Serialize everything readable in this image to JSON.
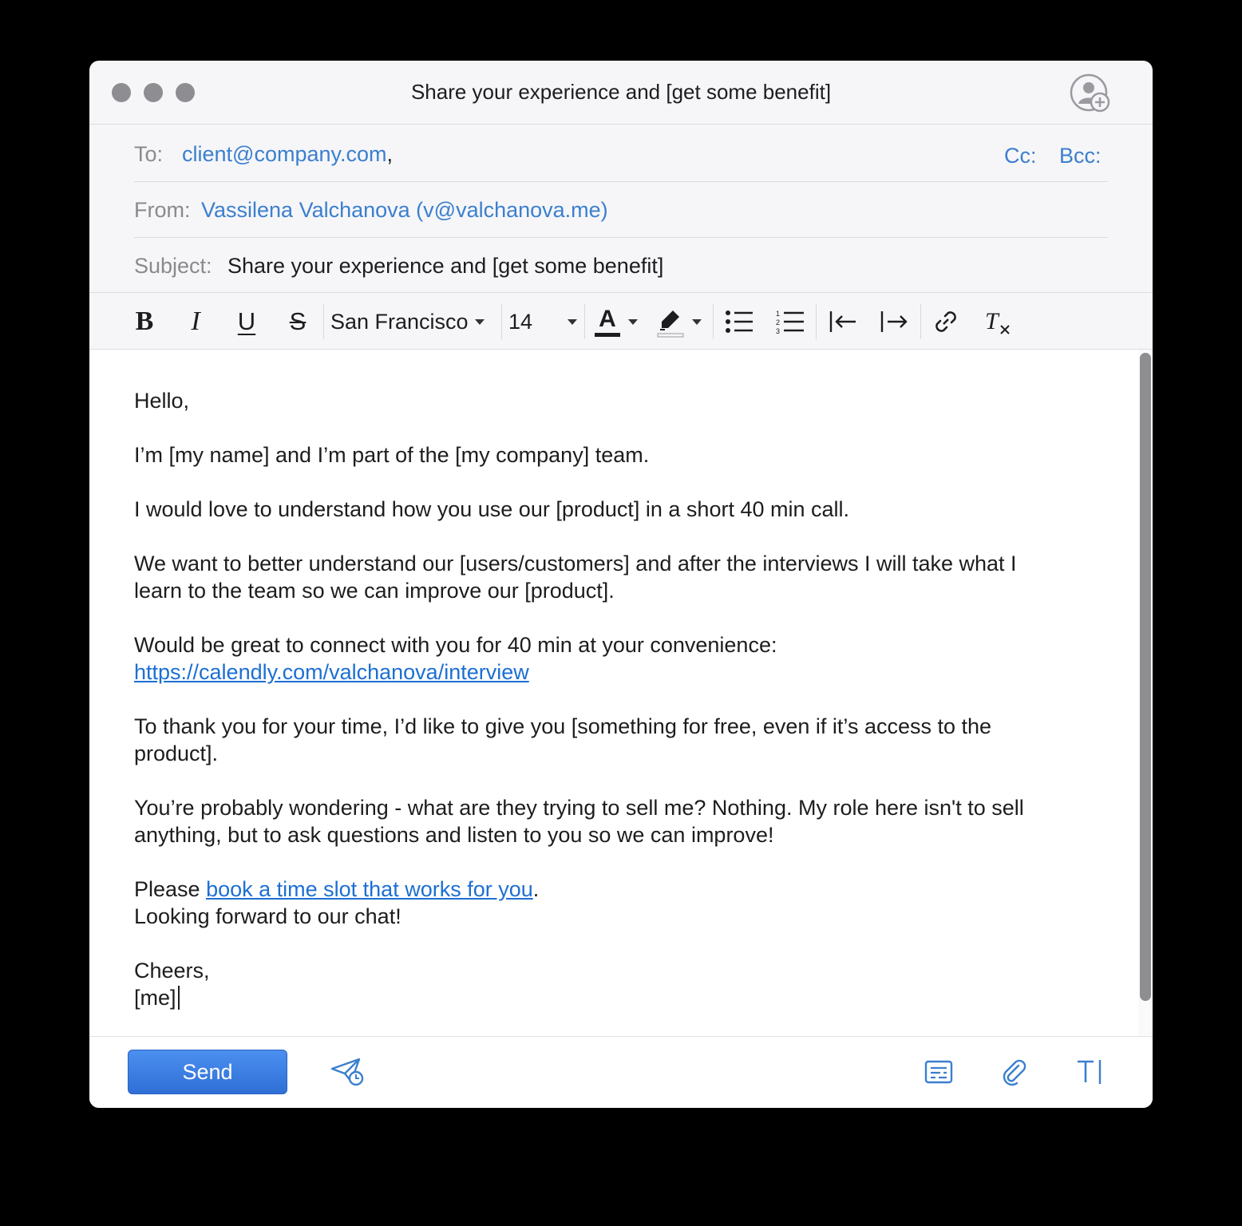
{
  "window": {
    "title": "Share your experience and [get some benefit]"
  },
  "header": {
    "to_label": "To:",
    "to_value": "client@company.com",
    "to_separator": ",",
    "cc_label": "Cc:",
    "bcc_label": "Bcc:",
    "from_label": "From:",
    "from_value": "Vassilena Valchanova (v@valchanova.me)",
    "subject_label": "Subject:",
    "subject_value": "Share your experience and [get some benefit]"
  },
  "toolbar": {
    "bold": "B",
    "italic": "I",
    "underline": "U",
    "strike": "S",
    "font_family": "San Francisco",
    "font_size": "14",
    "text_color_glyph": "A",
    "text_color": "#1d1d1f",
    "icons": [
      "bold-icon",
      "italic-icon",
      "underline-icon",
      "strikethrough-icon",
      "text-color-icon",
      "highlight-icon",
      "bulleted-list-icon",
      "numbered-list-icon",
      "outdent-icon",
      "indent-icon",
      "link-icon",
      "clear-format-icon"
    ]
  },
  "body": {
    "greeting": "Hello,",
    "p1": "I’m [my name] and I’m part of the [my company] team.",
    "p2": "I would love to understand how you use our [product] in a short 40 min call.",
    "p3_l1": "We want to better understand our [users/customers] and after the interviews I will take what I",
    "p3_l2": "learn to the team so we can improve our [product].",
    "p4_l1": "Would be great to connect with you for 40 min at your convenience:",
    "p4_link": "https://calendly.com/valchanova/interview",
    "p5_l1": "To thank you for your time, I’d like to give you [something for free, even if it’s access to the",
    "p5_l2": "product].",
    "p6_l1": "You’re probably wondering - what are they trying to sell me? Nothing. My role here isn't to sell",
    "p6_l2": "anything, but to ask questions and listen to you so we can improve!",
    "p7_prefix": "Please ",
    "p7_link": "book a time slot that works for you",
    "p7_suffix": ".",
    "p8": "Looking forward to our chat!",
    "closing": "Cheers,",
    "signature": "[me]"
  },
  "footer": {
    "send_label": "Send",
    "icons": [
      "send-later-icon",
      "template-icon",
      "attachment-icon",
      "signature-icon"
    ]
  },
  "colors": {
    "accent": "#3b7fcf",
    "link": "#1c6fd3",
    "send_button": "#2f6fd6"
  }
}
